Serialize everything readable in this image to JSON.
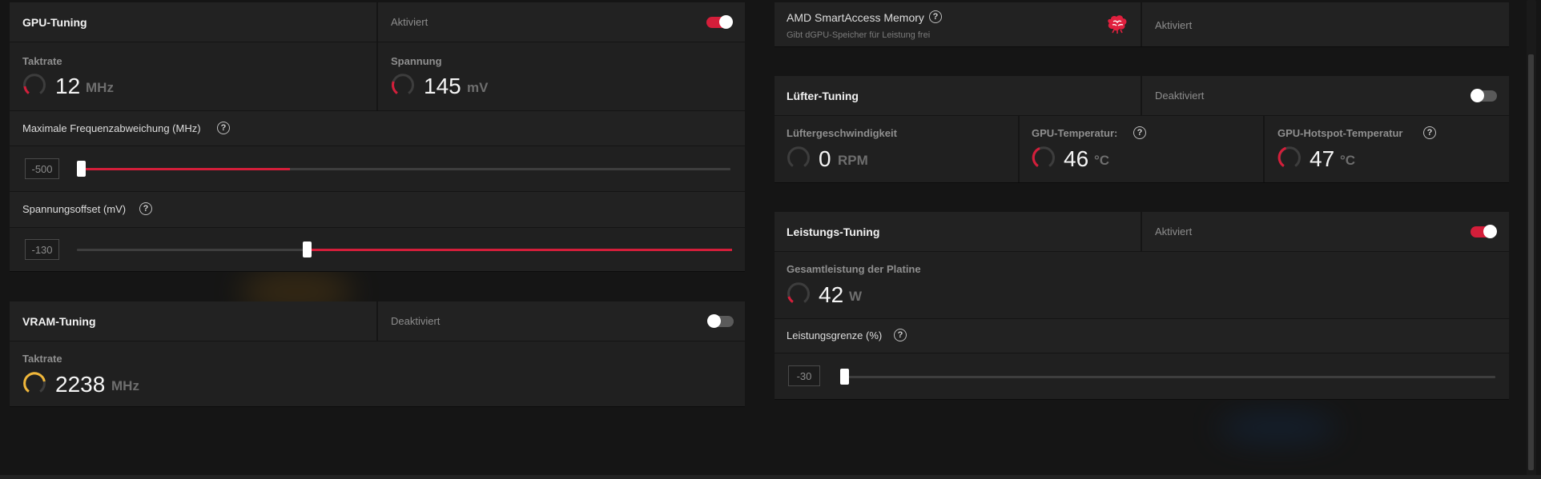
{
  "colors": {
    "accent": "#d41e3a",
    "vram_gauge": "#f0b73a",
    "panel": "#1f1f1f"
  },
  "gpu_tuning": {
    "title": "GPU-Tuning",
    "status": "Aktiviert",
    "enabled": true,
    "clock": {
      "label": "Taktrate",
      "value": "12",
      "unit": "MHz"
    },
    "voltage": {
      "label": "Spannung",
      "value": "145",
      "unit": "mV"
    },
    "max_freq": {
      "label": "Maximale Frequenzabweichung (MHz)",
      "value": "-500",
      "level": 0.32
    },
    "voltage_offset": {
      "label": "Spannungsoffset (mV)",
      "value": "-130",
      "level": 0.35
    }
  },
  "vram_tuning": {
    "title": "VRAM-Tuning",
    "status": "Deaktiviert",
    "enabled": false,
    "clock": {
      "label": "Taktrate",
      "value": "2238",
      "unit": "MHz"
    }
  },
  "smart_access": {
    "title": "AMD SmartAccess Memory",
    "subtitle": "Gibt dGPU-Speicher für Leistung frei",
    "status": "Aktiviert",
    "icon": "brain-icon"
  },
  "fan_tuning": {
    "title": "Lüfter-Tuning",
    "status": "Deaktiviert",
    "enabled": false,
    "fan_speed": {
      "label": "Lüftergeschwindigkeit",
      "value": "0",
      "unit": "RPM"
    },
    "gpu_temp": {
      "label": "GPU-Temperatur:",
      "value": "46",
      "unit": "°C"
    },
    "hotspot_temp": {
      "label": "GPU-Hotspot-Temperatur",
      "value": "47",
      "unit": "°C"
    }
  },
  "power_tuning": {
    "title": "Leistungs-Tuning",
    "status": "Aktiviert",
    "enabled": true,
    "board_power": {
      "label": "Gesamtleistung der Platine",
      "value": "42",
      "unit": "W"
    },
    "power_limit": {
      "label": "Leistungsgrenze (%)",
      "value": "-30",
      "level": 0.0
    }
  },
  "help_glyph": "?"
}
